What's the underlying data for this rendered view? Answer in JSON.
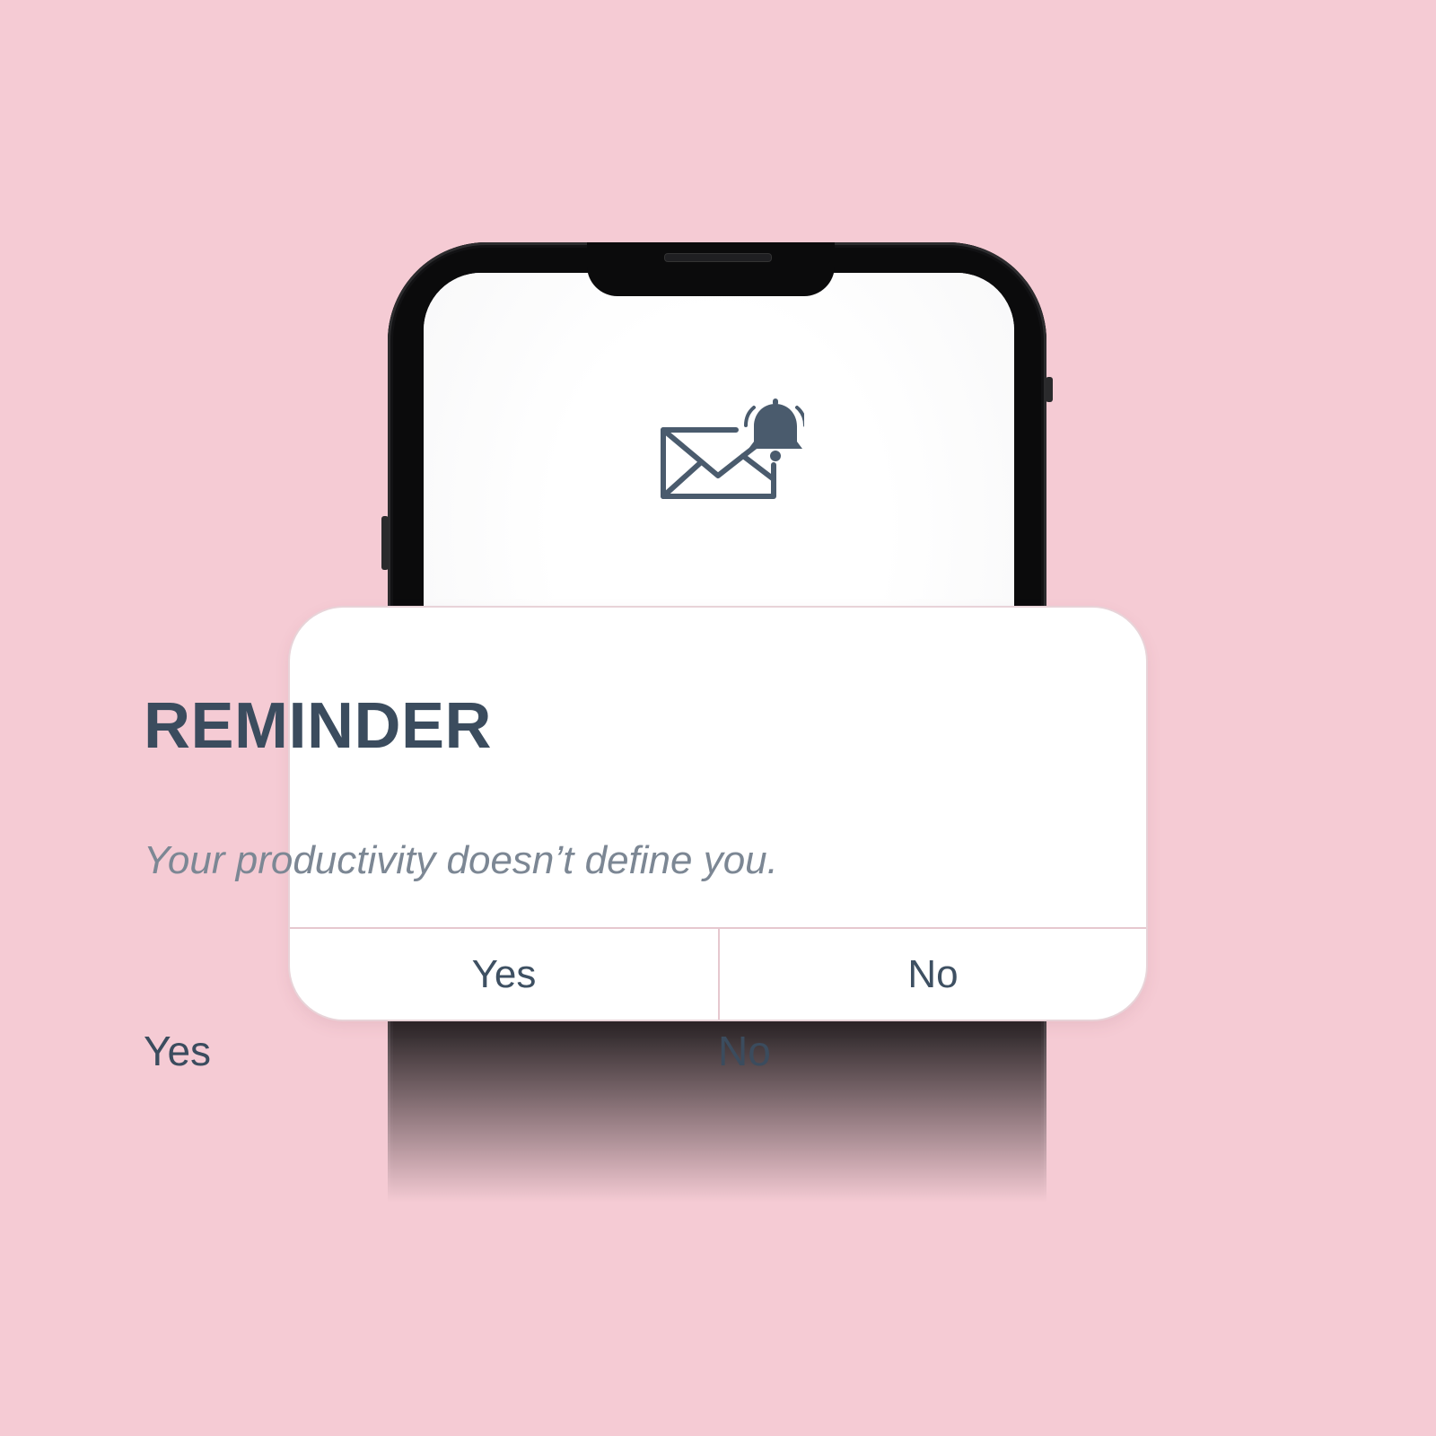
{
  "dialog": {
    "title": "REMINDER",
    "message": "Your productivity doesn’t define you.",
    "yes_label": "Yes",
    "no_label": "No"
  },
  "actions": {
    "yes_label": "Yes",
    "no_label": "No"
  },
  "icons": {
    "notification": "mail-bell-icon"
  },
  "colors": {
    "background": "#f5cbd4",
    "text_primary": "#3b4c5e",
    "text_secondary": "#7c8794",
    "divider": "#e6c8cf"
  }
}
